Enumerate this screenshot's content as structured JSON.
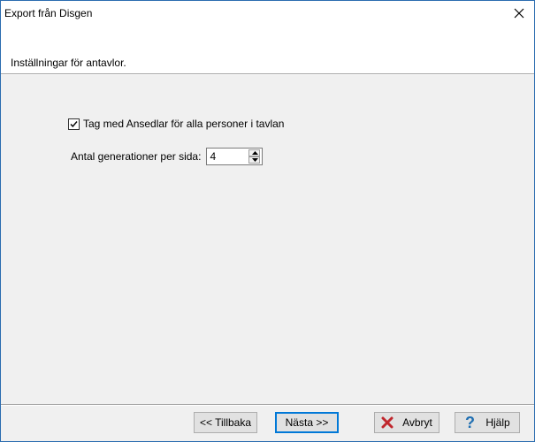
{
  "window": {
    "title": "Export från Disgen"
  },
  "header": {
    "subtitle": "Inställningar för antavlor."
  },
  "options": {
    "include_ansedlar_label": "Tag med Ansedlar för alla personer i tavlan",
    "include_ansedlar_checked": true,
    "generations_label": "Antal generationer per sida:",
    "generations_value": "4"
  },
  "buttons": {
    "back": "<< Tillbaka",
    "next": "Nästa >>",
    "cancel": "Avbryt",
    "help": "Hjälp"
  },
  "colors": {
    "cancel_icon": "#c0272d",
    "help_icon": "#1f6fb2",
    "focus": "#0078d7"
  }
}
